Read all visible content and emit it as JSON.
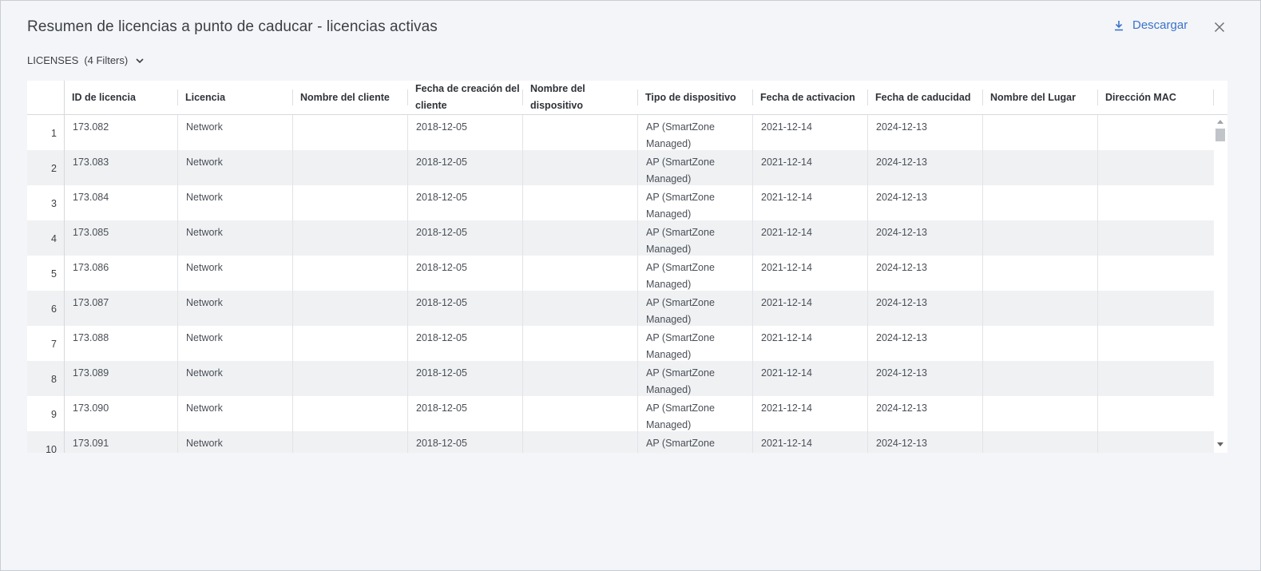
{
  "dialog": {
    "title": "Resumen de licencias a punto de caducar - licencias activas",
    "download_label": "Descargar",
    "download_icon": "download-icon",
    "close_icon": "close-icon"
  },
  "filters": {
    "label": "LICENSES",
    "count": "(4 Filters)",
    "icon": "chevron-down-icon"
  },
  "table": {
    "columns": [
      "ID de licencia",
      "Licencia",
      "Nombre del cliente",
      "Fecha de creación del cliente",
      "Nombre del dispositivo",
      "Tipo de dispositivo",
      "Fecha de activacion",
      "Fecha de caducidad",
      "Nombre del Lugar",
      "Dirección MAC"
    ],
    "rows": [
      {
        "n": "1",
        "id": "173.082",
        "lic": "Network",
        "client": "",
        "created": "2018-12-05",
        "device": "",
        "type": "AP (SmartZone Managed)",
        "act": "2021-12-14",
        "exp": "2024-12-13",
        "place": "",
        "mac": ""
      },
      {
        "n": "2",
        "id": "173.083",
        "lic": "Network",
        "client": "",
        "created": "2018-12-05",
        "device": "",
        "type": "AP (SmartZone Managed)",
        "act": "2021-12-14",
        "exp": "2024-12-13",
        "place": "",
        "mac": ""
      },
      {
        "n": "3",
        "id": "173.084",
        "lic": "Network",
        "client": "",
        "created": "2018-12-05",
        "device": "",
        "type": "AP (SmartZone Managed)",
        "act": "2021-12-14",
        "exp": "2024-12-13",
        "place": "",
        "mac": ""
      },
      {
        "n": "4",
        "id": "173.085",
        "lic": "Network",
        "client": "",
        "created": "2018-12-05",
        "device": "",
        "type": "AP (SmartZone Managed)",
        "act": "2021-12-14",
        "exp": "2024-12-13",
        "place": "",
        "mac": ""
      },
      {
        "n": "5",
        "id": "173.086",
        "lic": "Network",
        "client": "",
        "created": "2018-12-05",
        "device": "",
        "type": "AP (SmartZone Managed)",
        "act": "2021-12-14",
        "exp": "2024-12-13",
        "place": "",
        "mac": ""
      },
      {
        "n": "6",
        "id": "173.087",
        "lic": "Network",
        "client": "",
        "created": "2018-12-05",
        "device": "",
        "type": "AP (SmartZone Managed)",
        "act": "2021-12-14",
        "exp": "2024-12-13",
        "place": "",
        "mac": ""
      },
      {
        "n": "7",
        "id": "173.088",
        "lic": "Network",
        "client": "",
        "created": "2018-12-05",
        "device": "",
        "type": "AP (SmartZone Managed)",
        "act": "2021-12-14",
        "exp": "2024-12-13",
        "place": "",
        "mac": ""
      },
      {
        "n": "8",
        "id": "173.089",
        "lic": "Network",
        "client": "",
        "created": "2018-12-05",
        "device": "",
        "type": "AP (SmartZone Managed)",
        "act": "2021-12-14",
        "exp": "2024-12-13",
        "place": "",
        "mac": ""
      },
      {
        "n": "9",
        "id": "173.090",
        "lic": "Network",
        "client": "",
        "created": "2018-12-05",
        "device": "",
        "type": "AP (SmartZone Managed)",
        "act": "2021-12-14",
        "exp": "2024-12-13",
        "place": "",
        "mac": ""
      },
      {
        "n": "10",
        "id": "173.091",
        "lic": "Network",
        "client": "",
        "created": "2018-12-05",
        "device": "",
        "type": "AP (SmartZone Managed)",
        "act": "2021-12-14",
        "exp": "2024-12-13",
        "place": "",
        "mac": ""
      }
    ]
  }
}
